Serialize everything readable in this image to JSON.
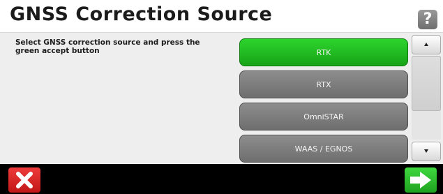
{
  "header": {
    "title": "GNSS Correction Source",
    "help_icon": "question-mark-icon",
    "help_label": "?"
  },
  "main": {
    "instructions": "Select GNSS correction source and press the green accept button",
    "options": [
      {
        "label": "RTK",
        "selected": true
      },
      {
        "label": "RTX",
        "selected": false
      },
      {
        "label": "OmniSTAR",
        "selected": false
      },
      {
        "label": "WAAS / EGNOS",
        "selected": false
      }
    ],
    "scroll_up_icon": "scroll-up-arrow-icon",
    "scroll_down_icon": "scroll-down-arrow-icon"
  },
  "footer": {
    "cancel_icon": "close-x-icon",
    "accept_icon": "right-arrow-icon"
  },
  "colors": {
    "selected": "#22c022",
    "option": "#7e7e7e",
    "cancel": "#d62828",
    "accept": "#2fbf2f"
  }
}
